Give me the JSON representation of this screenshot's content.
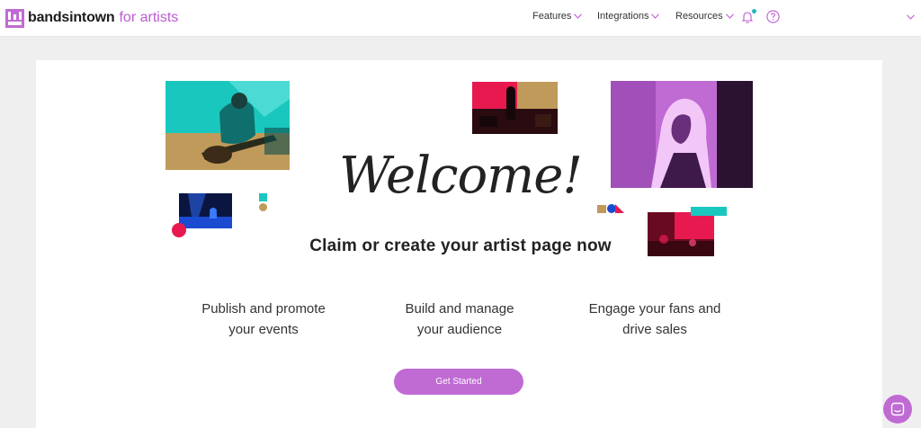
{
  "brand": {
    "name": "bandsintown",
    "suffix": "for artists",
    "accent": "#bc5bd2"
  },
  "nav": {
    "features": "Features",
    "integrations": "Integrations",
    "resources": "Resources"
  },
  "hero": {
    "welcome": "Welcome!",
    "subtitle": "Claim or create your artist page now"
  },
  "features": [
    {
      "line1": "Publish and promote",
      "line2": "your events"
    },
    {
      "line1": "Build and manage",
      "line2": "your audience"
    },
    {
      "line1": "Engage your fans and",
      "line2": "drive sales"
    }
  ],
  "cta": {
    "label": "Get Started",
    "color": "#c06ad3"
  },
  "colors": {
    "teal": "#19c7bf",
    "pink": "#e8194f",
    "gold": "#c09a5a",
    "purple": "#c06ad3",
    "blue": "#1a4bd1"
  },
  "icons": [
    "bandsintown-logo-icon",
    "chevron-down-icon",
    "bell-icon",
    "help-icon",
    "chat-icon"
  ]
}
